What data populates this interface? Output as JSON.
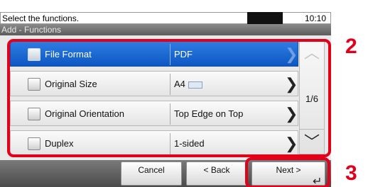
{
  "status": {
    "message": "Select the functions.",
    "time": "10:10"
  },
  "subtitle": "Add - Functions",
  "rows": [
    {
      "name": "File Format",
      "value": "PDF",
      "selected": true
    },
    {
      "name": "Original Size",
      "value": "A4",
      "selected": false
    },
    {
      "name": "Original Orientation",
      "value": "Top Edge on Top",
      "selected": false
    },
    {
      "name": "Duplex",
      "value": "1-sided",
      "selected": false
    }
  ],
  "scroll": {
    "page": "1/6",
    "up_icon": "chevron-up-icon",
    "down_icon": "chevron-down-icon"
  },
  "buttons": {
    "cancel": "Cancel",
    "back": "< Back",
    "next": "Next >"
  },
  "callouts": {
    "list": "2",
    "next": "3"
  },
  "colors": {
    "selected_row": "#1a63d0",
    "highlight": "#e3001b"
  }
}
